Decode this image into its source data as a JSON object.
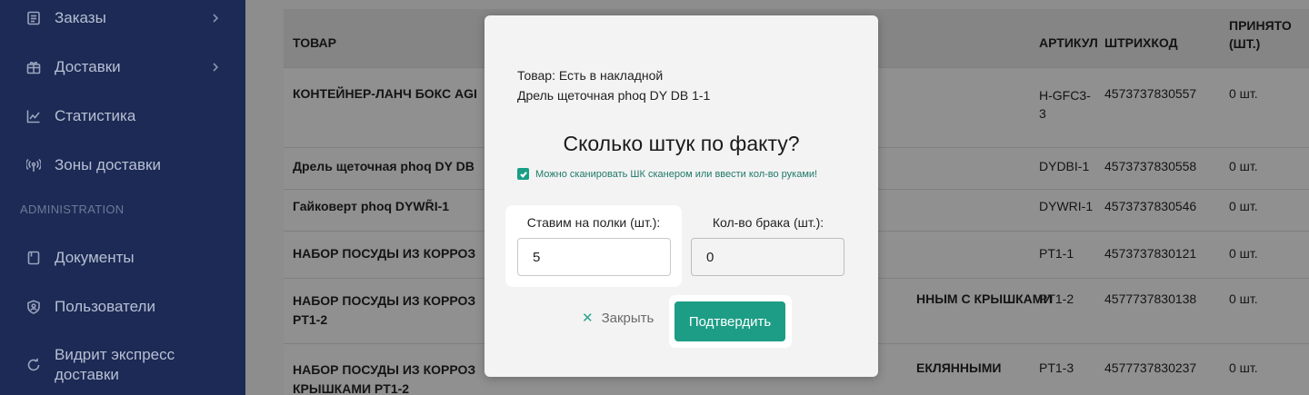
{
  "sidebar": {
    "items": [
      {
        "label": "Заказы",
        "icon": "list-icon",
        "chevron": true
      },
      {
        "label": "Доставки",
        "icon": "gift-icon",
        "chevron": true
      },
      {
        "label": "Статистика",
        "icon": "chart-icon",
        "chevron": false
      },
      {
        "label": "Зоны доставки",
        "icon": "signal-icon",
        "chevron": false
      }
    ],
    "section_label": "ADMINISTRATION",
    "admin_items": [
      {
        "label": "Документы",
        "icon": "document-icon"
      },
      {
        "label": "Пользователи",
        "icon": "shield-user-icon"
      },
      {
        "label_line1": "Видрит экспресс",
        "label_line2": "доставки",
        "icon": "refresh-icon"
      }
    ]
  },
  "table": {
    "headers": {
      "product": "ТОВАР",
      "article": "АРТИКУЛ",
      "barcode": "ШТРИХКОД",
      "accepted_line1": "ПРИНЯТО",
      "accepted_line2": "(ШТ.)"
    },
    "rows": [
      {
        "product": "КОНТЕЙНЕР-ЛАНЧ БОКС AGI",
        "product2": "",
        "product_right": "",
        "article": "H-GFC3-",
        "article2": "3",
        "barcode": "4573737830557",
        "accepted": "0 шт."
      },
      {
        "product": "Дрель щеточная phoq DY DB",
        "product2": "",
        "product_right": "",
        "article": "DYDBI-1",
        "article2": "",
        "barcode": "4573737830558",
        "accepted": "0 шт."
      },
      {
        "product": "Гайковерт phoq DYWR̃I-1",
        "product2": "",
        "product_right": "",
        "article": "DYWRI-1",
        "article2": "",
        "barcode": "4573737830546",
        "accepted": "0 шт."
      },
      {
        "product": "НАБОР ПОСУДЫ ИЗ КОРРОЗ",
        "product2": "",
        "product_right": "",
        "article": "PT1-1",
        "article2": "",
        "barcode": "4573737830121",
        "accepted": "0 шт."
      },
      {
        "product": "НАБОР ПОСУДЫ ИЗ КОРРОЗ",
        "product2": "PT1-2",
        "product_right": "ННЫМ С КРЫШКАМИ",
        "article": "PT1-2",
        "article2": "",
        "barcode": "4577737830138",
        "accepted": "0 шт."
      },
      {
        "product": "НАБОР ПОСУДЫ ИЗ КОРРОЗ",
        "product2": "КРЫШКАМИ PT1-2",
        "product_right": "ЕКЛЯННЫМИ",
        "article": "PT1-3",
        "article2": "",
        "barcode": "4577737830237",
        "accepted": "0 шт."
      }
    ]
  },
  "modal": {
    "line1": "Товар: Есть в накладной",
    "line2": "Дрель щеточная phoq DY DB 1-1",
    "title": "Сколько штук по факту?",
    "checkbox_label": "Можно сканировать ШК сканером или ввести кол-во руками!",
    "shelf_label": "Ставим на полки (шт.):",
    "shelf_value": "5",
    "defect_label": "Кол-во брака (шт.):",
    "defect_value": "0",
    "close_label": "Закрыть",
    "confirm_label": "Подтвердить"
  },
  "colors": {
    "sidebar_bg": "#1c2a55",
    "accent": "#1d9d86"
  }
}
